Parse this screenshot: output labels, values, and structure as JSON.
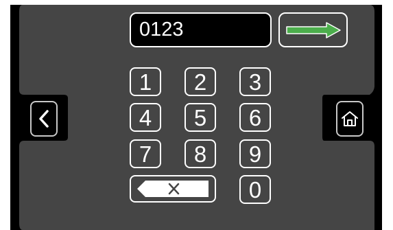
{
  "display": {
    "value": "0123"
  },
  "keypad": {
    "keys": [
      "1",
      "2",
      "3",
      "4",
      "5",
      "6",
      "7",
      "8",
      "9",
      "0"
    ]
  },
  "icons": {
    "enter": "arrow-right-icon",
    "back": "chevron-left-icon",
    "home": "home-icon",
    "backspace": "backspace-icon"
  },
  "colors": {
    "panel": "#454545",
    "background": "#000000",
    "accent": "#4cae4c",
    "text": "#ffffff"
  }
}
